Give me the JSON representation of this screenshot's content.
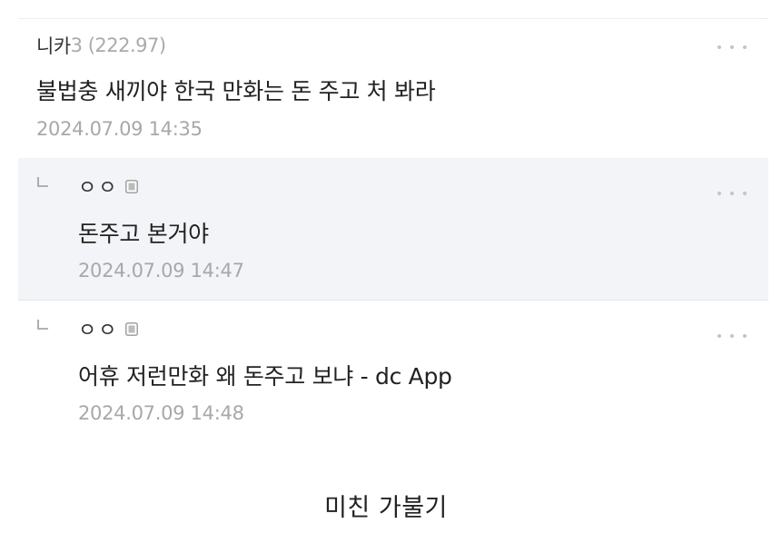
{
  "comments": [
    {
      "nickname": "니카",
      "ip_digit": "3",
      "ip": "(222.97)",
      "content": "불법충 새끼야 한국 만화는 돈 주고 처 봐라",
      "date": "2024.07.09 14:35",
      "menu_icon": "more-dots-icon"
    }
  ],
  "replies": [
    {
      "nickname": "ㅇㅇ",
      "badge_icon": "mobile-icon",
      "content": "돈주고 본거야",
      "date": "2024.07.09 14:47",
      "highlighted": true,
      "menu_icon": "more-dots-icon"
    },
    {
      "nickname": "ㅇㅇ",
      "badge_icon": "mobile-icon",
      "content": "어휴 저런만화 왜 돈주고 보냐 - dc App",
      "date": "2024.07.09 14:48",
      "highlighted": false,
      "menu_icon": "more-dots-icon"
    }
  ],
  "caption": "미친 가불기",
  "colors": {
    "reply_highlight_bg": "#f3f4f8",
    "text_primary": "#222222",
    "text_muted": "#a8a8a8"
  }
}
